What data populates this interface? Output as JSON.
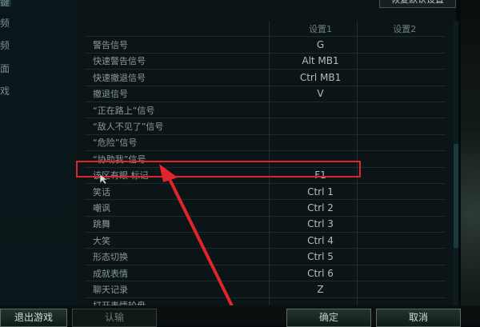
{
  "sidebar": {
    "items": [
      {
        "label": "键"
      },
      {
        "label": "频"
      },
      {
        "label": "频"
      },
      {
        "label": "面"
      },
      {
        "label": "戏"
      }
    ]
  },
  "top_button": {
    "label": "恢复默认设置"
  },
  "table": {
    "headers": {
      "binding1": "设置1",
      "binding2": "设置2"
    },
    "rows": [
      {
        "name": "警告信号",
        "key1": "G",
        "key2": ""
      },
      {
        "name": "快速警告信号",
        "key1": "Alt MB1",
        "key2": ""
      },
      {
        "name": "快速撤退信号",
        "key1": "Ctrl MB1",
        "key2": ""
      },
      {
        "name": "撤退信号",
        "key1": "V",
        "key2": ""
      },
      {
        "name": "“正在路上”信号",
        "key1": "",
        "key2": ""
      },
      {
        "name": "“敌人不见了”信号",
        "key1": "",
        "key2": ""
      },
      {
        "name": "“危险”信号",
        "key1": "",
        "key2": ""
      },
      {
        "name": "“协助我”信号",
        "key1": "",
        "key2": ""
      },
      {
        "name": "该区有眼 标记",
        "key1": "F1",
        "key2": ""
      },
      {
        "name": "笑话",
        "key1": "Ctrl 1",
        "key2": ""
      },
      {
        "name": "嘲讽",
        "key1": "Ctrl 2",
        "key2": ""
      },
      {
        "name": "跳舞",
        "key1": "Ctrl 3",
        "key2": ""
      },
      {
        "name": "大笑",
        "key1": "Ctrl 4",
        "key2": ""
      },
      {
        "name": "形态切换",
        "key1": "Ctrl 5",
        "key2": ""
      },
      {
        "name": "成就表情",
        "key1": "Ctrl 6",
        "key2": ""
      },
      {
        "name": "聊天记录",
        "key1": "Z",
        "key2": ""
      },
      {
        "name": "打开表情轮盘",
        "key1": "",
        "key2": ""
      }
    ]
  },
  "bottom": {
    "exit": "退出游戏",
    "surrender": "认输",
    "confirm": "确定",
    "cancel": "取消"
  },
  "colors": {
    "highlight": "#e0252a",
    "arrow": "#e0252a"
  }
}
